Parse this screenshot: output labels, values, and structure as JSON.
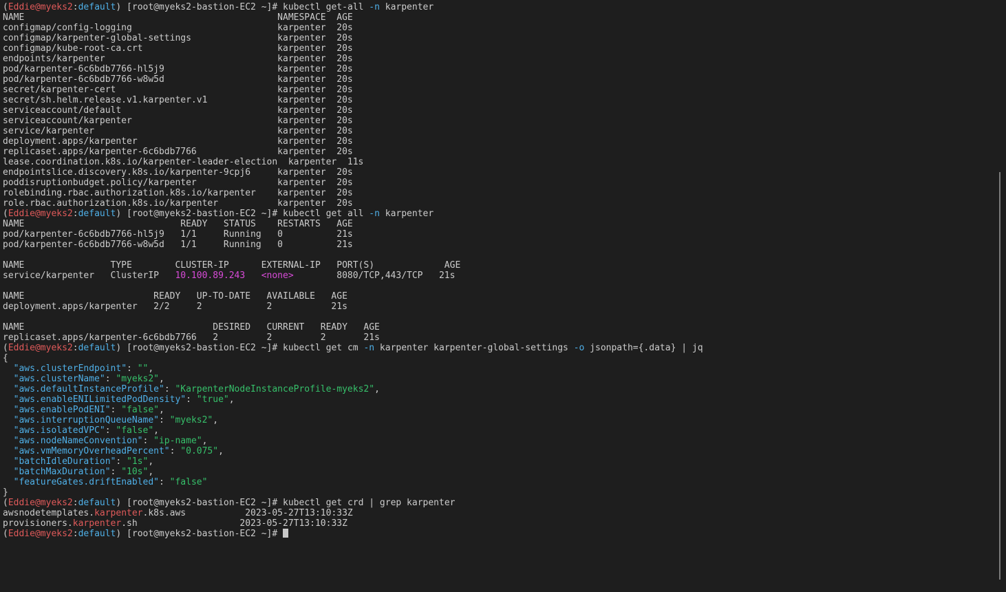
{
  "colors": {
    "background": "#1e1e1e",
    "text": "#cccccc",
    "user": "#e05a5a",
    "host_default": "#4fb0e8",
    "flag": "#4fb0e8",
    "highlight_magenta": "#d84bd8",
    "json_key": "#4fb0e8",
    "json_string": "#36c06a",
    "grep_match": "#e05a5a"
  },
  "prompt": {
    "open": "(",
    "user": "Eddie",
    "at_host": "@myeks2",
    "colon": ":",
    "context": "default",
    "rest": ") [root@myeks2-bastion-EC2 ~]# "
  },
  "commands": [
    {
      "pre": "kubectl get-all ",
      "flag": "-n",
      "post": " karpenter"
    },
    {
      "pre": "kubectl get all ",
      "flag": "-n",
      "post": " karpenter"
    },
    {
      "pre": "kubectl get cm ",
      "flag": "-n",
      "mid": " karpenter karpenter-global-settings ",
      "flag2": "-o",
      "post": " jsonpath={.data} | jq"
    },
    {
      "pre": "kubectl get crd | grep karpenter"
    }
  ],
  "getall": {
    "header": "NAME                                               NAMESPACE  AGE",
    "rows": [
      "configmap/config-logging                           karpenter  20s",
      "configmap/karpenter-global-settings                karpenter  20s",
      "configmap/kube-root-ca.crt                         karpenter  20s",
      "endpoints/karpenter                                karpenter  20s",
      "pod/karpenter-6c6bdb7766-hl5j9                     karpenter  20s",
      "pod/karpenter-6c6bdb7766-w8w5d                     karpenter  20s",
      "secret/karpenter-cert                              karpenter  20s",
      "secret/sh.helm.release.v1.karpenter.v1             karpenter  20s",
      "serviceaccount/default                             karpenter  20s",
      "serviceaccount/karpenter                           karpenter  20s",
      "service/karpenter                                  karpenter  20s",
      "deployment.apps/karpenter                          karpenter  20s",
      "replicaset.apps/karpenter-6c6bdb7766               karpenter  20s",
      "lease.coordination.k8s.io/karpenter-leader-election  karpenter  11s",
      "endpointslice.discovery.k8s.io/karpenter-9cpj6     karpenter  20s",
      "poddisruptionbudget.policy/karpenter               karpenter  20s",
      "rolebinding.rbac.authorization.k8s.io/karpenter    karpenter  20s",
      "role.rbac.authorization.k8s.io/karpenter           karpenter  20s"
    ]
  },
  "getall2": {
    "pods_header": "NAME                             READY   STATUS    RESTARTS   AGE",
    "pods": [
      "pod/karpenter-6c6bdb7766-hl5j9   1/1     Running   0          21s",
      "pod/karpenter-6c6bdb7766-w8w5d   1/1     Running   0          21s"
    ],
    "svc_header": "NAME                TYPE        CLUSTER-IP      EXTERNAL-IP   PORT(S)             AGE",
    "svc_row": {
      "a": "service/karpenter   ClusterIP   ",
      "ip": "10.100.89.243",
      "b": "   ",
      "none": "<none>",
      "c": "        8080/TCP,443/TCP   21s"
    },
    "deploy_header": "NAME                        READY   UP-TO-DATE   AVAILABLE   AGE",
    "deploy_row": "deployment.apps/karpenter   2/2     2            2           21s",
    "rs_header": "NAME                                   DESIRED   CURRENT   READY   AGE",
    "rs_row": "replicaset.apps/karpenter-6c6bdb7766   2         2         2       21s"
  },
  "json": {
    "open": "{",
    "close": "}",
    "entries": [
      {
        "key": "\"aws.clusterEndpoint\"",
        "val": "\"\"",
        "comma": ","
      },
      {
        "key": "\"aws.clusterName\"",
        "val": "\"myeks2\"",
        "comma": ","
      },
      {
        "key": "\"aws.defaultInstanceProfile\"",
        "val": "\"KarpenterNodeInstanceProfile-myeks2\"",
        "comma": ","
      },
      {
        "key": "\"aws.enableENILimitedPodDensity\"",
        "val": "\"true\"",
        "comma": ","
      },
      {
        "key": "\"aws.enablePodENI\"",
        "val": "\"false\"",
        "comma": ","
      },
      {
        "key": "\"aws.interruptionQueueName\"",
        "val": "\"myeks2\"",
        "comma": ","
      },
      {
        "key": "\"aws.isolatedVPC\"",
        "val": "\"false\"",
        "comma": ","
      },
      {
        "key": "\"aws.nodeNameConvention\"",
        "val": "\"ip-name\"",
        "comma": ","
      },
      {
        "key": "\"aws.vmMemoryOverheadPercent\"",
        "val": "\"0.075\"",
        "comma": ","
      },
      {
        "key": "\"batchIdleDuration\"",
        "val": "\"1s\"",
        "comma": ","
      },
      {
        "key": "\"batchMaxDuration\"",
        "val": "\"10s\"",
        "comma": ","
      },
      {
        "key": "\"featureGates.driftEnabled\"",
        "val": "\"false\"",
        "comma": ""
      }
    ]
  },
  "crd": [
    {
      "pre": "awsnodetemplates.",
      "match": "karpenter",
      "post": ".k8s.aws           2023-05-27T13:10:33Z"
    },
    {
      "pre": "provisioners.",
      "match": "karpenter",
      "post": ".sh                   2023-05-27T13:10:33Z"
    }
  ]
}
